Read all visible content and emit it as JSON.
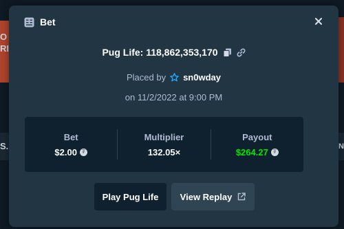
{
  "modal": {
    "title": "Bet",
    "header_icon": "bet-slip-icon",
    "close_icon": "close-icon"
  },
  "game": {
    "title": "Pug Life: 118,862,353,170",
    "copy_icon": "copy-icon",
    "link_icon": "link-icon"
  },
  "placed": {
    "prefix": "Placed by",
    "user_icon": "vip-star-icon",
    "username": "sn0wday",
    "date": "on 11/2/2022 at 9:00 PM"
  },
  "stats": {
    "bet": {
      "label": "Bet",
      "value": "$2.00",
      "icon": "coin-icon"
    },
    "multiplier": {
      "label": "Multiplier",
      "value": "132.05×"
    },
    "payout": {
      "label": "Payout",
      "value": "$264.27",
      "icon": "coin-icon",
      "color": "#00e701"
    }
  },
  "buttons": {
    "play": {
      "label": "Play Pug Life"
    },
    "replay": {
      "label": "View Replay",
      "icon": "external-link-icon"
    }
  },
  "colors": {
    "modal_bg": "#213543",
    "panel_bg": "#0f212e",
    "secondary_button": "#2f4553",
    "muted_text": "#b1bad3",
    "accent_star": "#1fa8ff",
    "positive": "#00e701"
  },
  "background": {
    "left_letters": "O\nRI",
    "left_strip_letter": "S.",
    "right_strip_letter": "N"
  }
}
